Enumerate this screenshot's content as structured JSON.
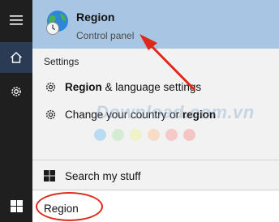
{
  "best_match": {
    "title": "Region",
    "subtitle": "Control panel",
    "icon": "globe-clock-icon"
  },
  "section_label": "Settings",
  "items": [
    {
      "bold": "Region",
      "rest": " & language settings",
      "icon": "gear-icon"
    },
    {
      "prefix": "Change your country or ",
      "bold": "region",
      "icon": "gear-icon"
    }
  ],
  "watermark": "Download.com.vn",
  "dot_colors": [
    "#b9dcf2",
    "#d4ecd2",
    "#f0f2c9",
    "#f7dcc8",
    "#f6c9c9",
    "#f3c5c5"
  ],
  "search_my_stuff": "Search my stuff",
  "search": {
    "value": "Region"
  },
  "annotation_color": "#e0281a",
  "rail": {
    "icons": [
      "hamburger-menu-icon",
      "home-icon",
      "gear-icon",
      "windows-logo-icon"
    ]
  }
}
